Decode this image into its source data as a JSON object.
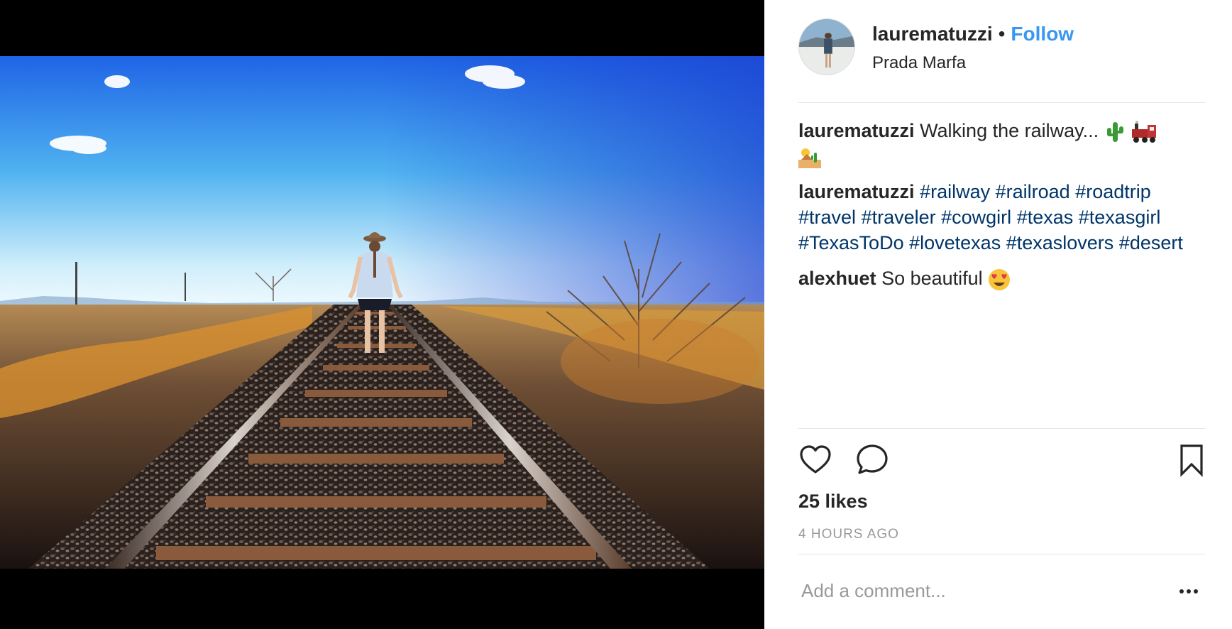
{
  "post": {
    "username": "laurematuzzi",
    "separator": "•",
    "follow_label": "Follow",
    "location": "Prada Marfa",
    "comments": [
      {
        "author": "laurematuzzi",
        "text": "Walking the railway...",
        "emojis": [
          "cactus",
          "steam-locomotive",
          "desert"
        ]
      },
      {
        "author": "laurematuzzi",
        "hashtags": [
          "#railway",
          "#railroad",
          "#roadtrip",
          "#travel",
          "#traveler",
          "#cowgirl",
          "#texas",
          "#texasgirl",
          "#TexasToDo",
          "#lovetexas",
          "#texaslovers",
          "#desert"
        ]
      },
      {
        "author": "alexhuet",
        "text": "So beautiful",
        "emojis": [
          "heart-eyes"
        ]
      }
    ],
    "likes": "25 likes",
    "timestamp": "4 HOURS AGO",
    "comment_placeholder": "Add a comment...",
    "more_label": "•••"
  },
  "colors": {
    "follow": "#3897f0",
    "hashtag": "#003569",
    "text": "#262626",
    "muted": "#999999",
    "divider": "#e6e6e6"
  },
  "icons": [
    "heart-icon",
    "comment-icon",
    "bookmark-icon",
    "more-icon"
  ]
}
